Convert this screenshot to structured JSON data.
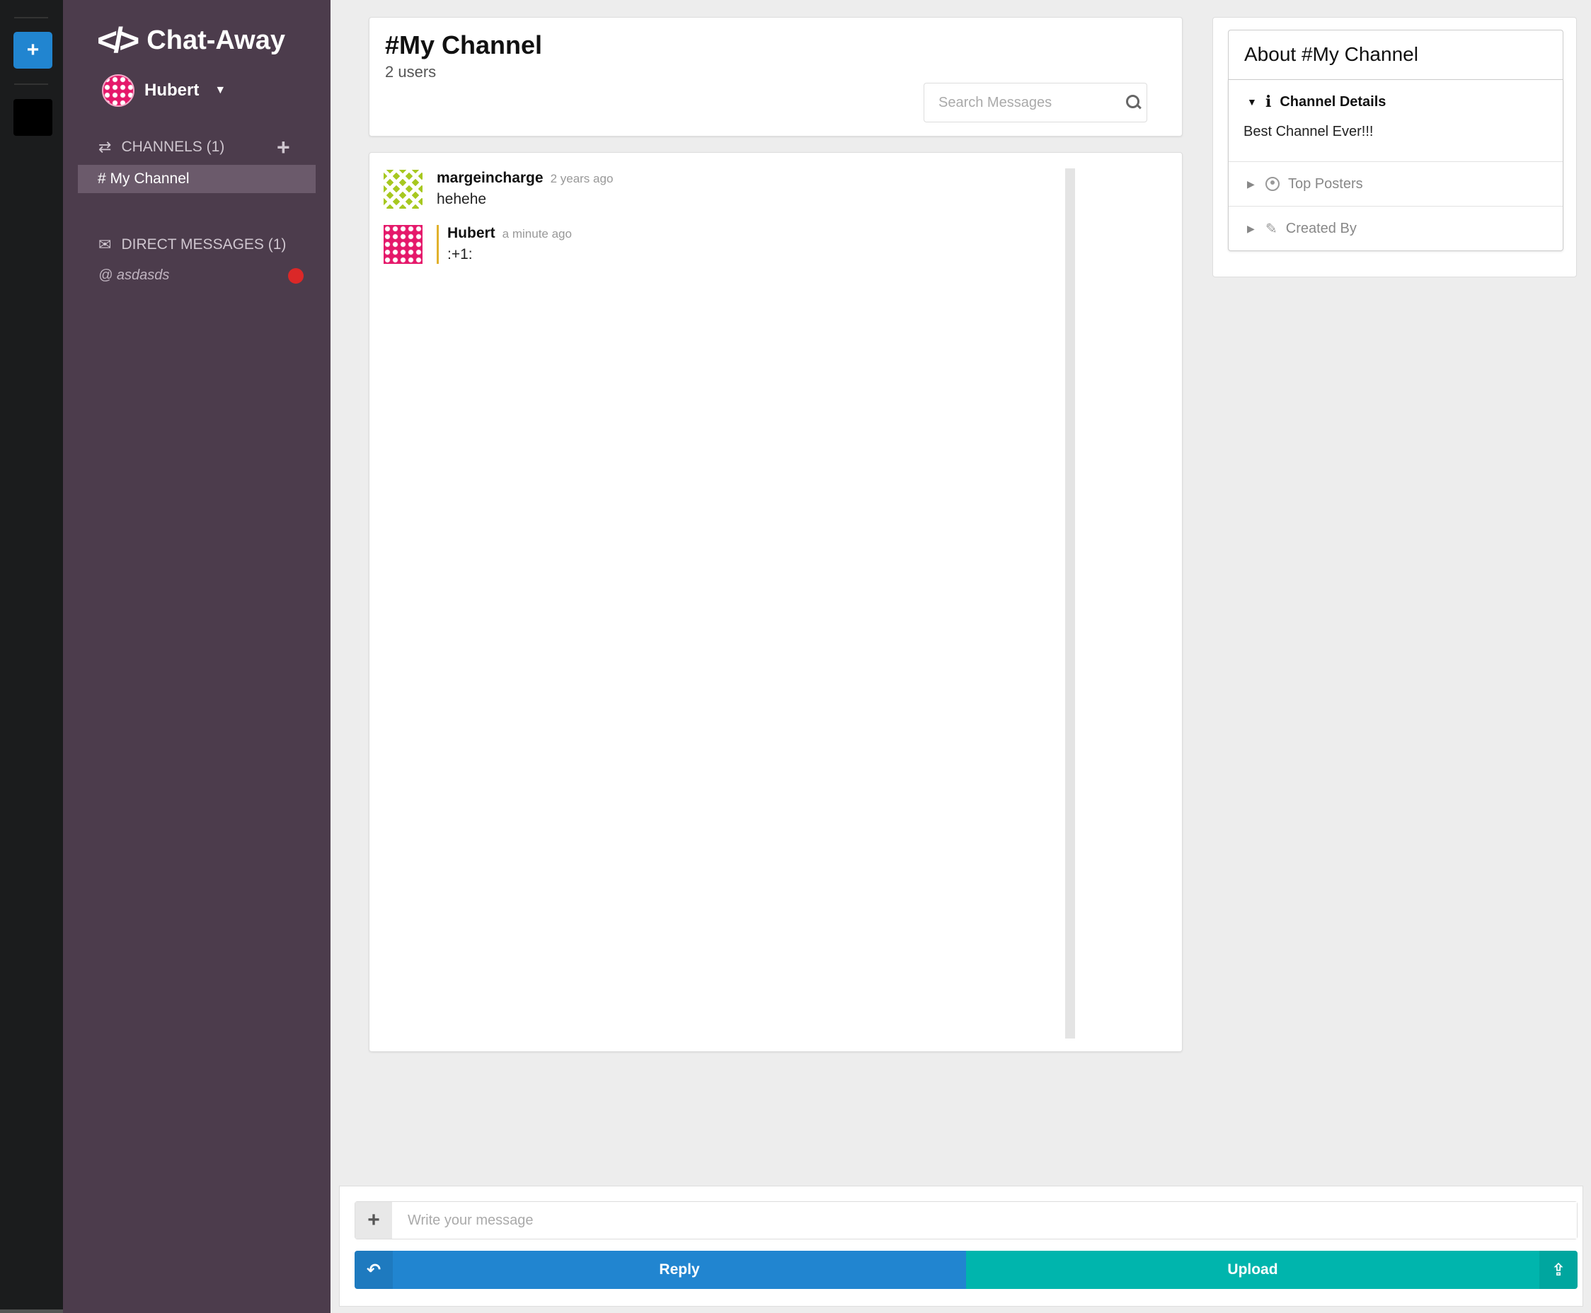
{
  "app": {
    "brand_name": "Chat-Away",
    "current_user": "Hubert",
    "accent_color": "#2185d0",
    "sidebar_color": "#4c3c4c"
  },
  "sidebar": {
    "channels_label": "CHANNELS (1)",
    "channels": [
      {
        "label": "# My Channel",
        "active": true
      }
    ],
    "dm_label": "DIRECT MESSAGES (1)",
    "direct_messages": [
      {
        "label": "@ asdasds",
        "status": "offline"
      }
    ]
  },
  "header": {
    "channel_title": "#My Channel",
    "user_count": "2 users",
    "search_placeholder": "Search Messages"
  },
  "messages": [
    {
      "author": "margeincharge",
      "time": "2 years ago",
      "text": "hehehe"
    },
    {
      "author": "Hubert",
      "time": "a minute ago",
      "text": ":+1:",
      "own": true
    }
  ],
  "about": {
    "title": "About #My Channel",
    "sections": [
      {
        "label": "Channel Details",
        "icon": "info-icon",
        "expanded": true,
        "content": "Best Channel Ever!!!"
      },
      {
        "label": "Top Posters",
        "icon": "user-circle-icon",
        "expanded": false
      },
      {
        "label": "Created By",
        "icon": "pencil-icon",
        "expanded": false
      }
    ]
  },
  "composer": {
    "placeholder": "Write your message",
    "reply_label": "Reply",
    "upload_label": "Upload",
    "reply_color": "#2185d0",
    "upload_color": "#00b5ad"
  }
}
